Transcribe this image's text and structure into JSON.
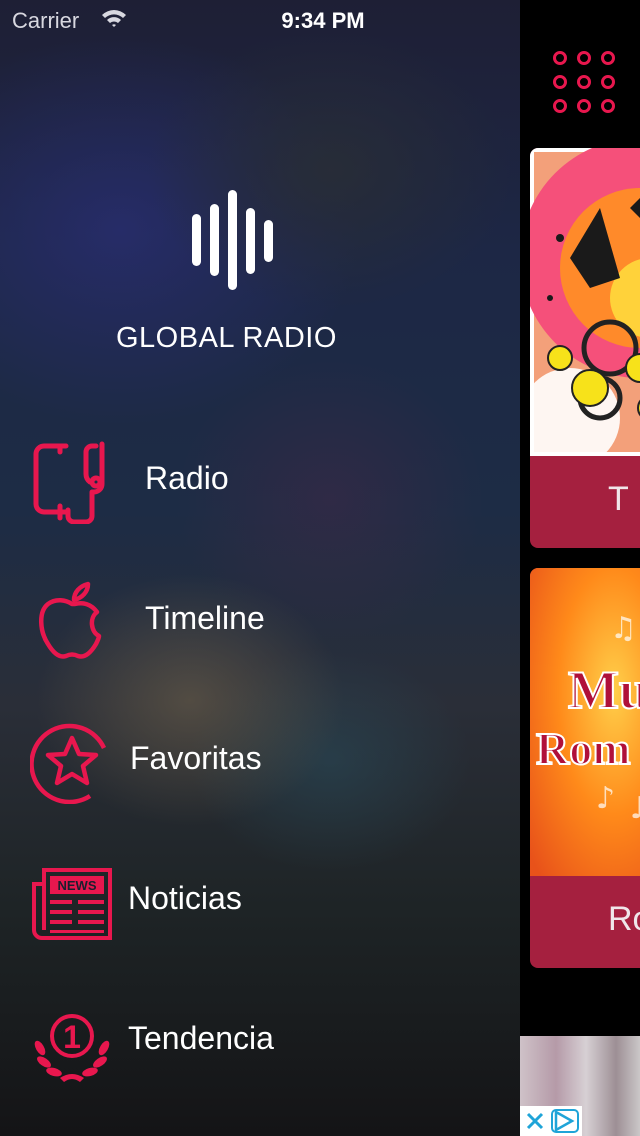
{
  "status_bar": {
    "carrier": "Carrier",
    "time": "9:34 PM"
  },
  "app": {
    "name": "GLOBAL RADIO"
  },
  "menu": [
    {
      "label": "Radio",
      "icon": "radio-phone-icon"
    },
    {
      "label": "Timeline",
      "icon": "apple-icon"
    },
    {
      "label": "Favoritas",
      "icon": "star-circle-icon"
    },
    {
      "label": "Noticias",
      "icon": "newspaper-icon"
    },
    {
      "label": "Tendencia",
      "icon": "laurel-number-one-icon"
    }
  ],
  "news_icon_text": "NEWS",
  "trend_icon_text": "1",
  "cards": [
    {
      "caption": "T"
    },
    {
      "caption": "Ro",
      "art_text_1": "Mu",
      "art_text_2": "Rom"
    }
  ],
  "colors": {
    "accent": "#e8174e",
    "card_caption_bg": "#a5203f",
    "background": "#000000"
  }
}
